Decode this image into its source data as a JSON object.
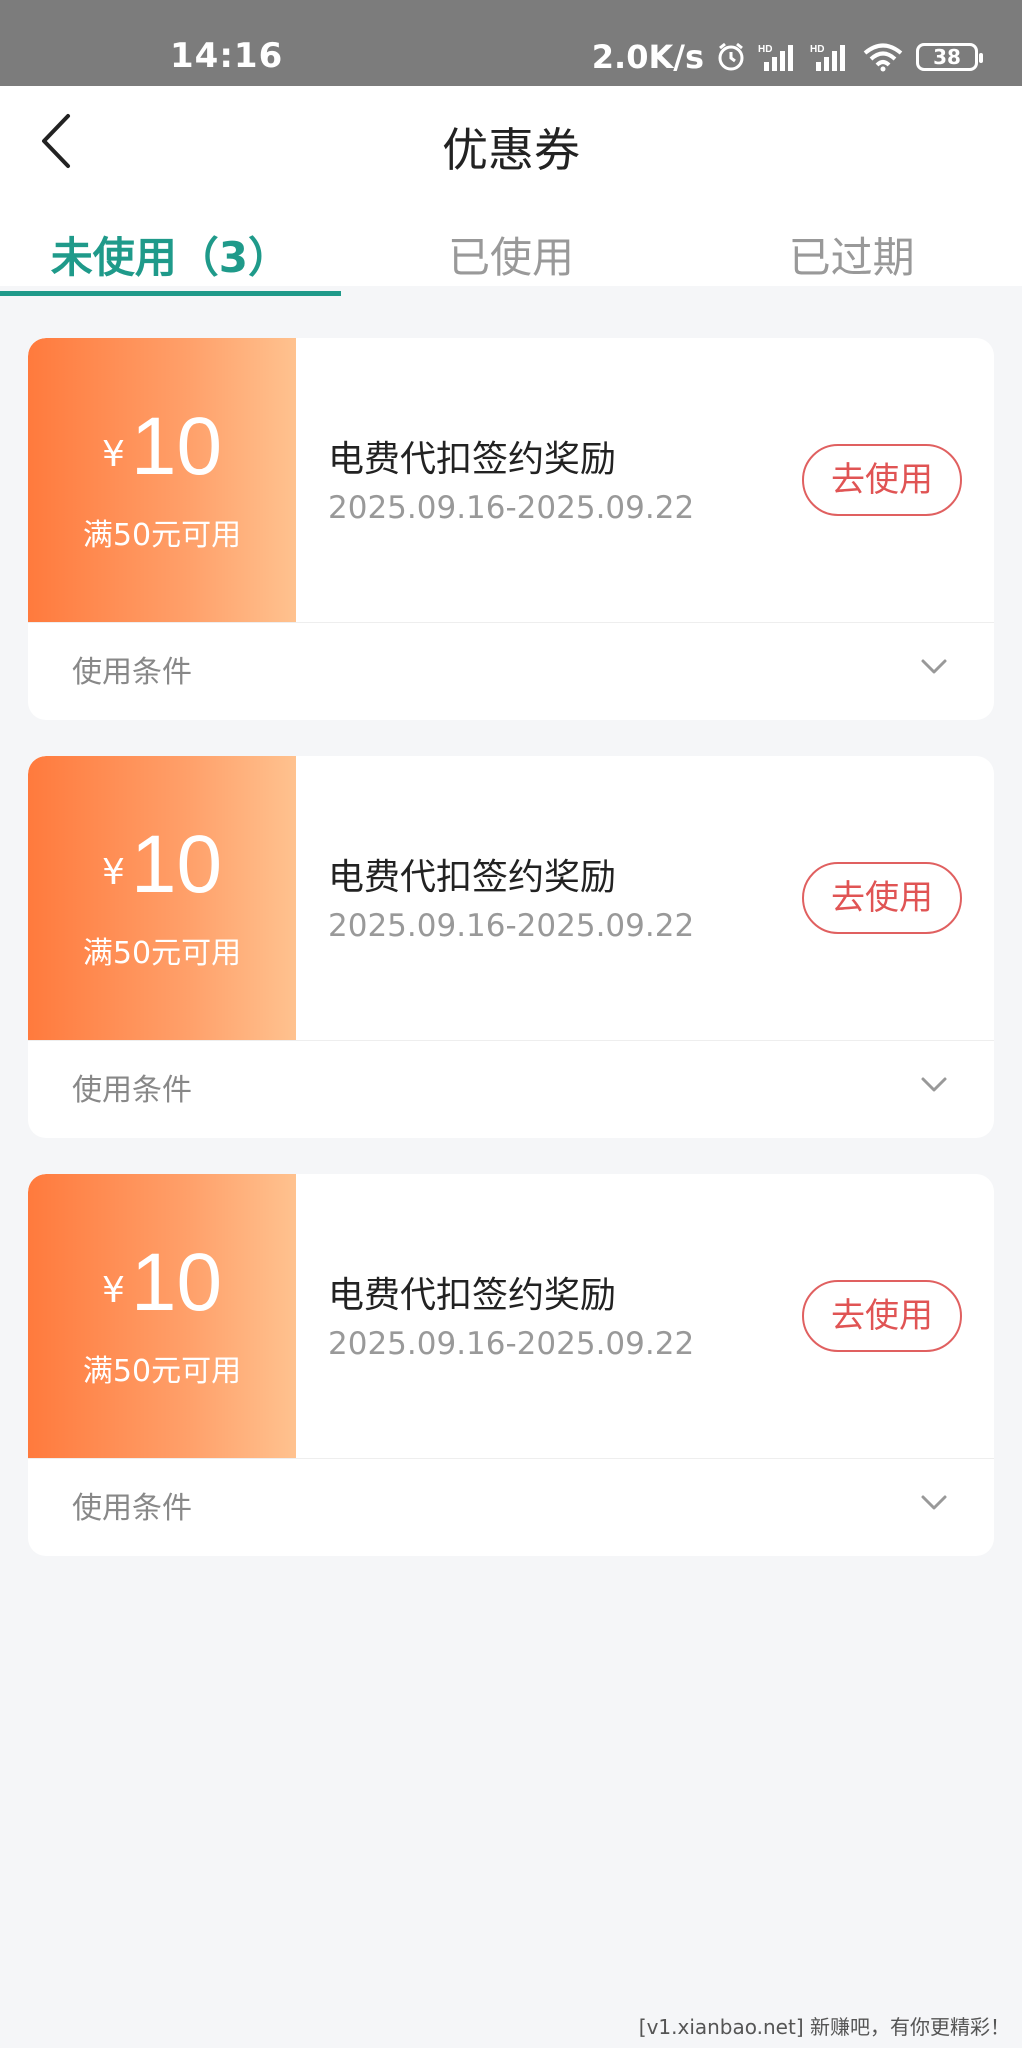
{
  "status_bar": {
    "time": "14:16",
    "net_speed": "2.0K/s",
    "battery": "38",
    "icons": [
      "alarm-icon",
      "signal-hd-icon",
      "signal-hd-icon",
      "wifi-icon",
      "battery-icon"
    ]
  },
  "header": {
    "back_icon": "chevron-left-icon",
    "title": "优惠券"
  },
  "tabs": [
    {
      "label": "未使用（3）",
      "active": true
    },
    {
      "label": "已使用",
      "active": false
    },
    {
      "label": "已过期",
      "active": false
    }
  ],
  "coupons": [
    {
      "currency": "¥",
      "amount": "10",
      "condition": "满50元可用",
      "name": "电费代扣签约奖励",
      "date_range": "2025.09.16-2025.09.22",
      "button": "去使用",
      "footer": "使用条件"
    },
    {
      "currency": "¥",
      "amount": "10",
      "condition": "满50元可用",
      "name": "电费代扣签约奖励",
      "date_range": "2025.09.16-2025.09.22",
      "button": "去使用",
      "footer": "使用条件"
    },
    {
      "currency": "¥",
      "amount": "10",
      "condition": "满50元可用",
      "name": "电费代扣签约奖励",
      "date_range": "2025.09.16-2025.09.22",
      "button": "去使用",
      "footer": "使用条件"
    }
  ],
  "colors": {
    "accent": "#1f9a8a",
    "coupon_orange": "#ff7a3d",
    "button_red": "#e05454"
  },
  "watermark": "[v1.xianbao.net] 新赚吧，有你更精彩！"
}
